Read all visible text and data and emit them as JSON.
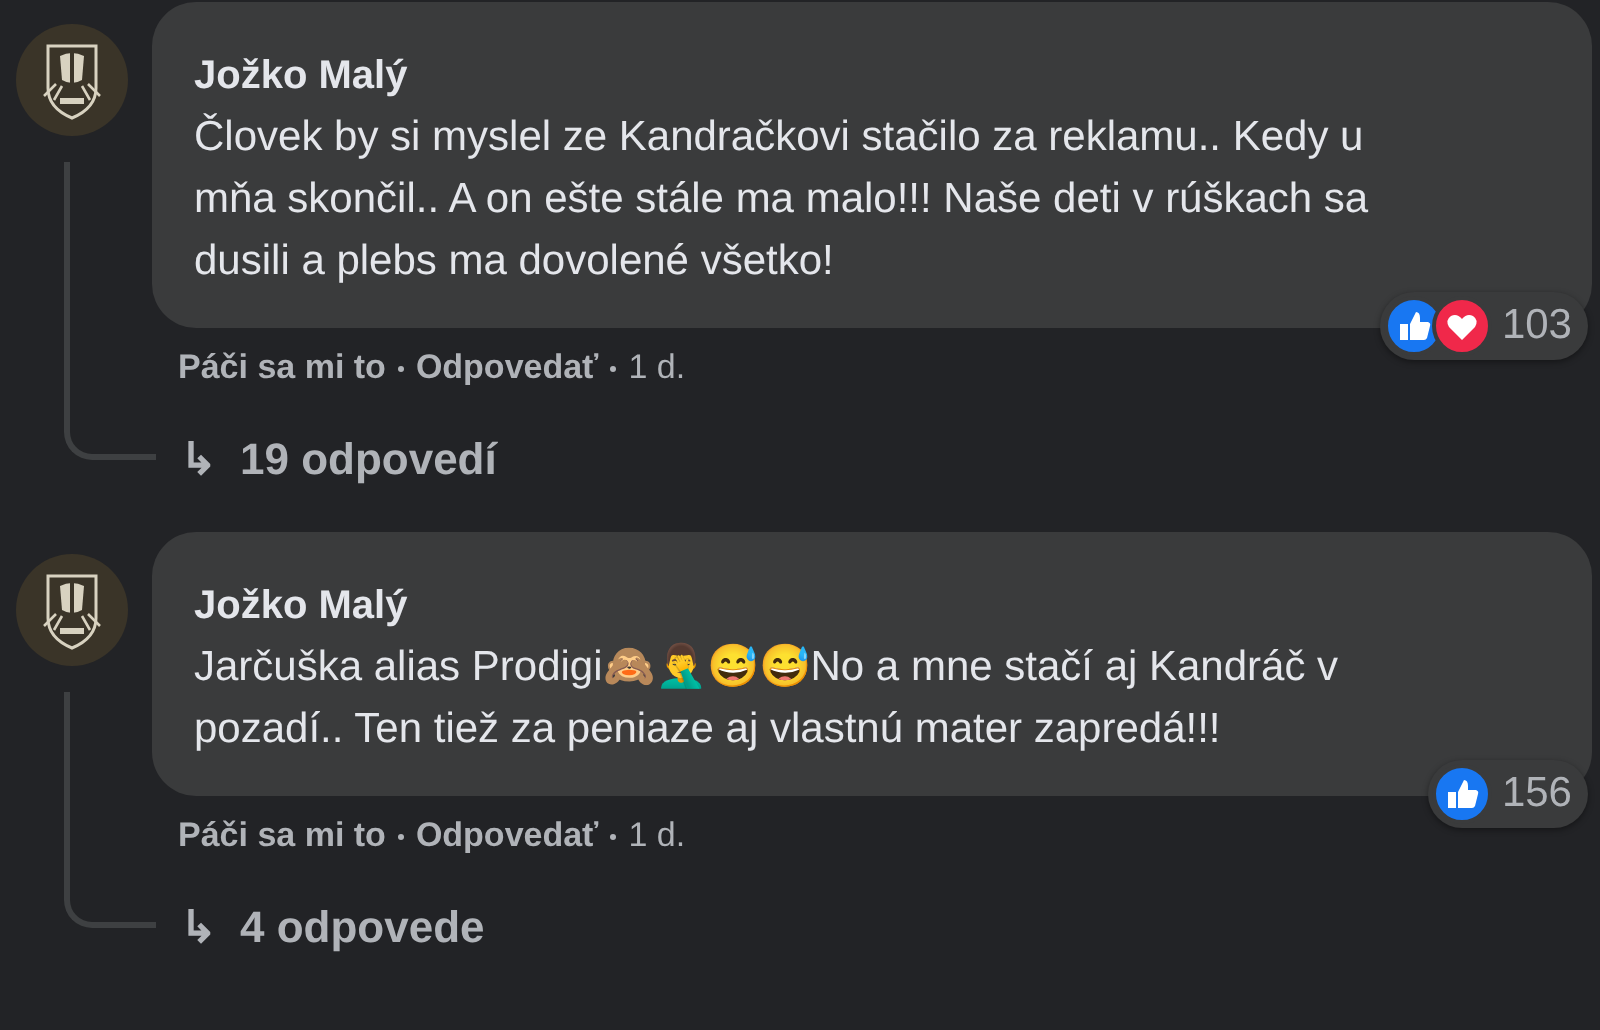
{
  "comments": [
    {
      "author": "Jožko Malý",
      "text": "Človek by si myslel ze Kandračkovi stačilo za reklamu.. Kedy u mňa skončil.. A on ešte stále ma malo!!! Naše deti v rúškach sa dusili a plebs ma dovolené všetko!",
      "reactions": [
        {
          "kind": "like"
        },
        {
          "kind": "love"
        }
      ],
      "reaction_count": "103",
      "like_label": "Páči sa mi to",
      "reply_label": "Odpovedať",
      "time": "1 d.",
      "replies_arrow": "↳",
      "replies": "19 odpovedí"
    },
    {
      "author": "Jožko Malý",
      "text": "Jarčuška alias Prodigi🙈🤦‍♂️😅😅No a mne stačí aj Kandráč v pozadí.. Ten tiež za peniaze aj vlastnú mater zapredá!!!",
      "reactions": [
        {
          "kind": "like"
        }
      ],
      "reaction_count": "156",
      "like_label": "Páči sa mi to",
      "reply_label": "Odpovedať",
      "time": "1 d.",
      "replies_arrow": "↳",
      "replies": "4 odpovede"
    }
  ]
}
